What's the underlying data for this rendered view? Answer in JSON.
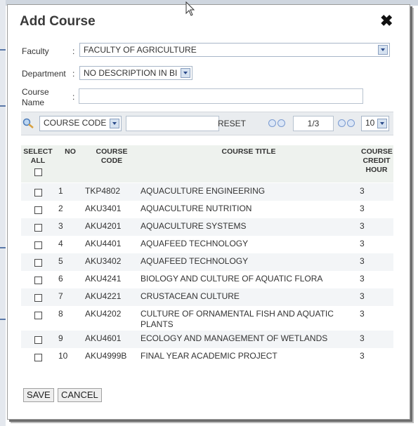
{
  "dialog": {
    "title": "Add Course",
    "close_symbol": "✖"
  },
  "form": {
    "faculty_label": "Faculty",
    "faculty_value": "FACULTY OF AGRICULTURE",
    "department_label": "Department",
    "department_value": "NO DESCRIPTION IN BI",
    "course_name_label_1": "Course",
    "course_name_label_2": "Name",
    "course_name_value": "",
    "colon": ":"
  },
  "toolbar": {
    "search_field_value": "COURSE CODE",
    "search_input_value": "",
    "reset_label": "RESET",
    "page_display": "1/3",
    "page_size_value": "10"
  },
  "table": {
    "headers": {
      "select_all_1": "SELECT",
      "select_all_2": "ALL",
      "no": "NO",
      "course_code_1": "COURSE",
      "course_code_2": "CODE",
      "course_title": "COURSE TITLE",
      "credit_1": "COURSE",
      "credit_2": "CREDIT",
      "credit_3": "HOUR"
    },
    "rows": [
      {
        "no": "1",
        "code": "TKP4802",
        "title": "AQUACULTURE ENGINEERING",
        "title2": "",
        "credit": "3"
      },
      {
        "no": "2",
        "code": "AKU3401",
        "title": "AQUACULTURE NUTRITION",
        "title2": "",
        "credit": "3"
      },
      {
        "no": "3",
        "code": "AKU4201",
        "title": "AQUACULTURE SYSTEMS",
        "title2": "",
        "credit": "3"
      },
      {
        "no": "4",
        "code": "AKU4401",
        "title": "AQUAFEED TECHNOLOGY",
        "title2": "",
        "credit": "3"
      },
      {
        "no": "5",
        "code": "AKU3402",
        "title": "AQUAFEED TECHNOLOGY",
        "title2": "",
        "credit": "3"
      },
      {
        "no": "6",
        "code": "AKU4241",
        "title": "BIOLOGY AND CULTURE OF AQUATIC FLORA",
        "title2": "",
        "credit": "3"
      },
      {
        "no": "7",
        "code": "AKU4221",
        "title": "CRUSTACEAN CULTURE",
        "title2": "",
        "credit": "3"
      },
      {
        "no": "8",
        "code": "AKU4202",
        "title": "CULTURE OF ORNAMENTAL FISH AND AQUATIC",
        "title2": "PLANTS",
        "credit": "3"
      },
      {
        "no": "9",
        "code": "AKU4601",
        "title": "ECOLOGY AND MANAGEMENT OF WETLANDS",
        "title2": "",
        "credit": "3"
      },
      {
        "no": "10",
        "code": "AKU4999B",
        "title": "FINAL YEAR ACADEMIC PROJECT",
        "title2": "",
        "credit": "3"
      }
    ]
  },
  "footer": {
    "save_label": "SAVE",
    "cancel_label": "CANCEL"
  }
}
